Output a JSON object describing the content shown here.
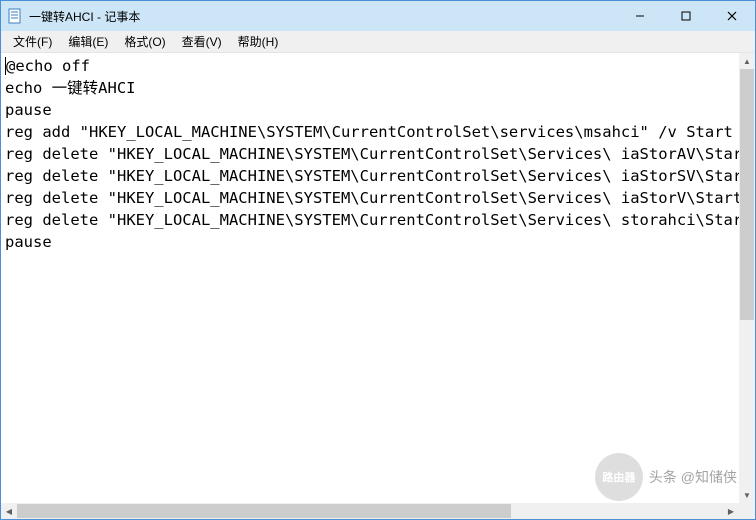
{
  "window": {
    "title": "一键转AHCI - 记事本"
  },
  "menu": {
    "file": "文件(F)",
    "edit": "编辑(E)",
    "format": "格式(O)",
    "view": "查看(V)",
    "help": "帮助(H)"
  },
  "content": {
    "lines": [
      "@echo off",
      "echo 一键转AHCI",
      "pause",
      "reg add \"HKEY_LOCAL_MACHINE\\SYSTEM\\CurrentControlSet\\services\\msahci\" /v Start /t reg_d",
      "reg delete \"HKEY_LOCAL_MACHINE\\SYSTEM\\CurrentControlSet\\Services\\ iaStorAV\\StartOverrid",
      "reg delete \"HKEY_LOCAL_MACHINE\\SYSTEM\\CurrentControlSet\\Services\\ iaStorSV\\StartOverrid",
      "reg delete \"HKEY_LOCAL_MACHINE\\SYSTEM\\CurrentControlSet\\Services\\ iaStorV\\StartOverride",
      "reg delete \"HKEY_LOCAL_MACHINE\\SYSTEM\\CurrentControlSet\\Services\\ storahci\\StartOverrid",
      "pause"
    ]
  },
  "watermark": {
    "logo": "路由器",
    "text": "头条 @知储侠"
  }
}
